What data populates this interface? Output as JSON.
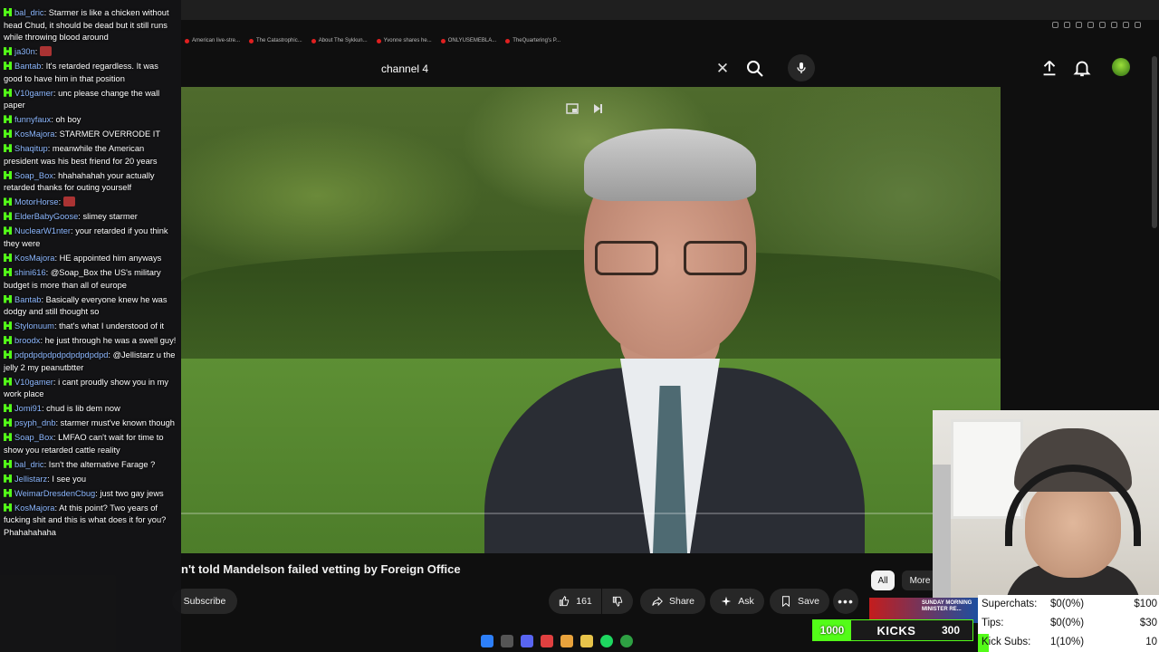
{
  "browser": {
    "bookmarks": [
      "American live-stre...",
      "The Catastrophic...",
      "About The Sykkun...",
      "Yvonne shares he...",
      "ONLYUSEMEBLA...",
      "TheQuartering's P..."
    ]
  },
  "header": {
    "search_value": "channel 4",
    "clear_icon": "close-icon",
    "search_icon": "search-icon",
    "mic_icon": "mic-icon",
    "upload_icon": "upload-icon",
    "bell_icon": "bell-icon"
  },
  "video": {
    "title": "n't told Mandelson failed vetting by Foreign Office",
    "likes": "161",
    "share_label": "Share",
    "ask_label": "Ask",
    "save_label": "Save",
    "subscribe_label": "Subscribe",
    "chips": [
      "All",
      "More"
    ]
  },
  "chat": [
    {
      "user": "bal_dric",
      "text": "Starmer is like a chicken without head Chud, it should be dead but it still runs while throwing blood around"
    },
    {
      "user": "ja30n",
      "text": ""
    },
    {
      "user": "Bantab",
      "text": "It's retarded regardless. It was good to have him in that position"
    },
    {
      "user": "V10gamer",
      "text": "unc please change the wall paper"
    },
    {
      "user": "funnyfaux",
      "text": "oh boy"
    },
    {
      "user": "KosMajora",
      "text": "STARMER OVERRODE IT"
    },
    {
      "user": "Shaqitup",
      "text": "meanwhile the American president was his best friend for 20 years"
    },
    {
      "user": "Soap_Box",
      "text": "hhahahahah your actually retarded thanks for outing yourself"
    },
    {
      "user": "MotorHorse",
      "text": ""
    },
    {
      "user": "ElderBabyGoose",
      "text": "slimey starmer"
    },
    {
      "user": "NuclearW1nter",
      "text": "your retarded if you think they were"
    },
    {
      "user": "KosMajora",
      "text": "HE appointed him anyways"
    },
    {
      "user": "shini616",
      "text": "@Soap_Box the US's military budget is more than all of europe"
    },
    {
      "user": "Bantab",
      "text": "Basically everyone knew he was dodgy and still thought so"
    },
    {
      "user": "Stylonuum",
      "text": "that's what I understood of it"
    },
    {
      "user": "broodx",
      "text": "he just through he was a swell guy!"
    },
    {
      "user": "pdpdpdpdpdpdpdpdpdpd",
      "text": "@Jellistarz u the jelly 2 my peanutbtter"
    },
    {
      "user": "V10gamer",
      "text": "i cant proudly show you in my work place"
    },
    {
      "user": "Jomi91",
      "text": "chud is lib dem now"
    },
    {
      "user": "psyph_dnb",
      "text": "starmer must've known though"
    },
    {
      "user": "Soap_Box",
      "text": "LMFAO can't wait for time to show you retarded cattle reality"
    },
    {
      "user": "bal_dric",
      "text": "Isn't the alternative Farage ?"
    },
    {
      "user": "Jellistarz",
      "text": "I see you"
    },
    {
      "user": "WeimarDresdenCbug",
      "text": "just two gay jews"
    },
    {
      "user": "KosMajora",
      "text": "At this point? Two years of fucking shit and this is what does it for you? Phahahahaha"
    }
  ],
  "overlay": {
    "kicks_count": "1000",
    "kicks_label": "KICKS",
    "kicks_goal": "300",
    "news_text": "SUNDAY MORNING MINISTER RE...",
    "stats": [
      {
        "label": "Superchats:",
        "value": "$0(0%)",
        "goal": "$100"
      },
      {
        "label": "Tips:",
        "value": "$0(0%)",
        "goal": "$30"
      },
      {
        "label": "Kick Subs:",
        "value": "1(10%)",
        "goal": "10"
      }
    ],
    "colors": {
      "kick_green": "#53fc18",
      "chat_user": "#8db8ff"
    }
  }
}
